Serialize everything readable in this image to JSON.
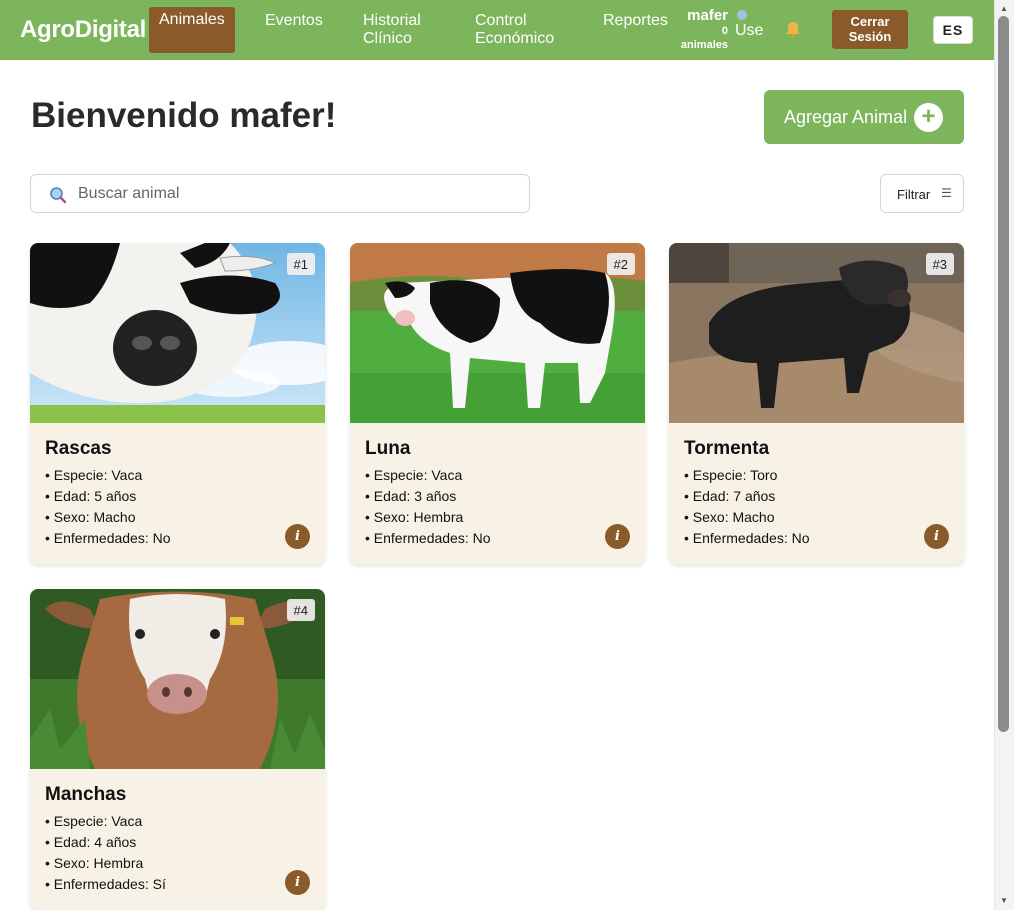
{
  "navbar": {
    "brand": "AgroDigital",
    "items": [
      {
        "label": "Animales",
        "active": true
      },
      {
        "label": "Eventos",
        "active": false
      },
      {
        "label": "Historial Clínico",
        "active": false
      },
      {
        "label": "Control Económico",
        "active": false
      },
      {
        "label": "Reportes",
        "active": false
      }
    ],
    "user_name": "mafer",
    "user_count": "0",
    "user_count_label": "animales",
    "user_icon_label": "Use",
    "logout_label": "Cerrar Sesión",
    "lang": "ES",
    "colors": {
      "bar": "#7cb55c",
      "active": "#8a5a2b"
    }
  },
  "main": {
    "welcome": "Bienvenido mafer!",
    "add_button": "Agregar Animal",
    "search_placeholder": "Buscar animal",
    "filter_label": "Filtrar"
  },
  "animals": [
    {
      "num": "#1",
      "name": "Rascas",
      "especie": "• Especie: Vaca",
      "edad": "• Edad: 5 años",
      "sexo": "• Sexo: Macho",
      "enfermedades": "• Enfermedades: No"
    },
    {
      "num": "#2",
      "name": "Luna",
      "especie": "• Especie: Vaca",
      "edad": "• Edad: 3 años",
      "sexo": "• Sexo: Hembra",
      "enfermedades": "• Enfermedades: No"
    },
    {
      "num": "#3",
      "name": "Tormenta",
      "especie": "• Especie: Toro",
      "edad": "• Edad: 7 años",
      "sexo": "• Sexo: Macho",
      "enfermedades": "• Enfermedades: No"
    },
    {
      "num": "#4",
      "name": "Manchas",
      "especie": "• Especie: Vaca",
      "edad": "• Edad: 4 años",
      "sexo": "• Sexo: Hembra",
      "enfermedades": "• Enfermedades: Sí"
    }
  ],
  "info_glyph": "i"
}
